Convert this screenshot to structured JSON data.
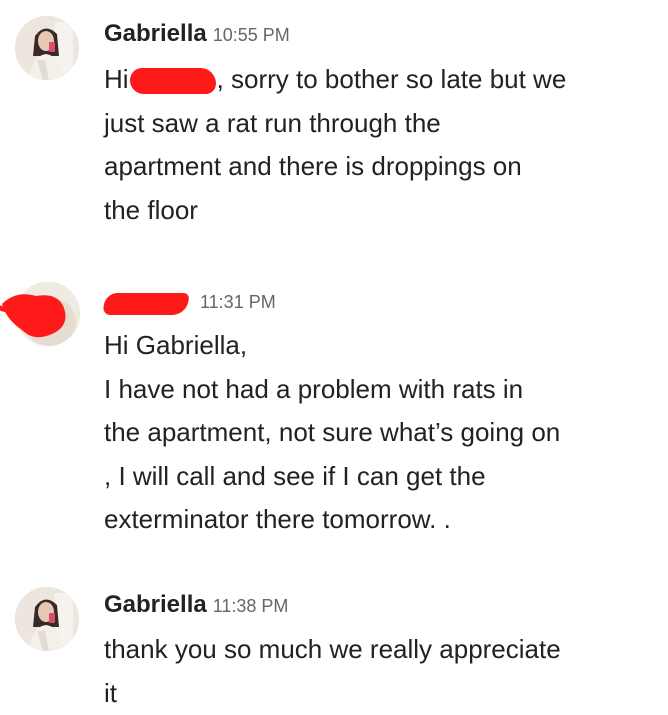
{
  "messages": [
    {
      "sender": "Gabriella",
      "time": "10:55 PM",
      "avatar_icon": "profile-photo-icon",
      "lines": [
        {
          "before": "Hi",
          "after": ", sorry to bother so late   but we"
        },
        "just saw a rat run through the",
        "apartment and there is droppings on",
        "the floor"
      ]
    },
    {
      "sender": "",
      "time": "11:31 PM",
      "avatar_icon": "profile-photo-icon",
      "lines": [
        "Hi Gabriella,",
        "I have not had a problem  with rats in",
        "the apartment, not sure what’s going on",
        ", I will call and see if I can get the",
        "exterminator there tomorrow.  ."
      ]
    },
    {
      "sender": "Gabriella",
      "time": "11:38 PM",
      "avatar_icon": "profile-photo-icon",
      "lines": [
        "thank you so much we really appreciate",
        "it"
      ]
    }
  ],
  "colors": {
    "redaction": "#ff1a1a",
    "text": "#222222",
    "timestamp": "#666666"
  }
}
